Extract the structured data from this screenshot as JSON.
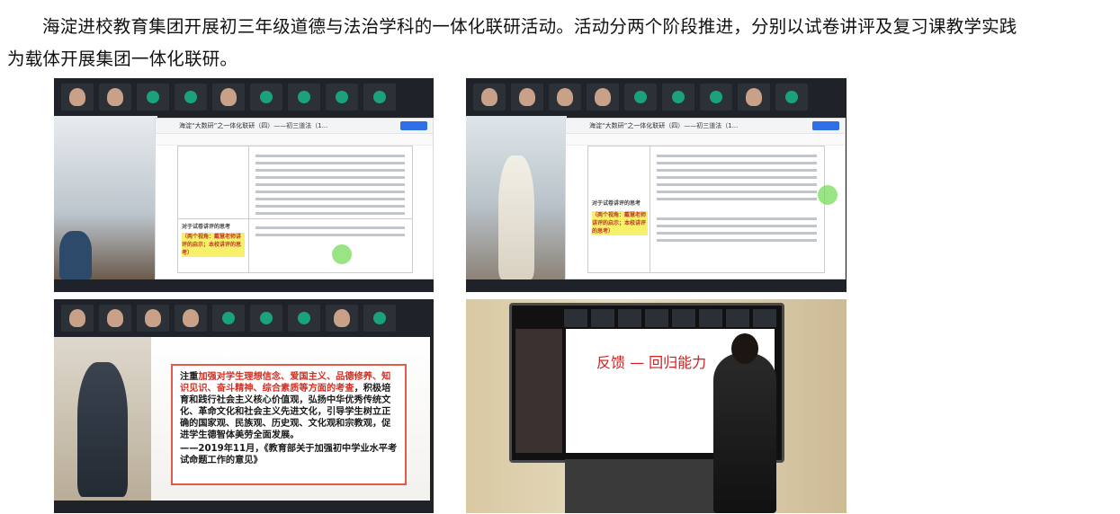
{
  "article": {
    "paragraph_line1": "海淀进校教育集团开展初三年级道德与法治学科的一体化联研活动。活动分两个阶段推进，分别以试卷讲评及复习课教学实践",
    "paragraph_line2": "为载体开展集团一体化联研。"
  },
  "photos": [
    {
      "doc_title": "海淀“大数研”之一体化联研（四）——初三道法（1...",
      "cell_heading": "对于试卷讲评的思考",
      "highlight": "（两个视角：戴慧老师讲评的启示；本校讲评的思考）"
    },
    {
      "doc_title": "海淀“大数研”之一体化联研（四）——初三道法（1...",
      "cell_heading": "对于试卷讲评的思考",
      "highlight": "（两个视角：戴慧老师讲评的启示；本校讲评的思考）"
    },
    {
      "slide_lines": [
        {
          "text": "注重",
          "red": false
        },
        {
          "text": "加强对学生理想信念、爱国主义、品德修养、知识见识、奋斗精神、综合素质等方面的考查",
          "red": true
        },
        {
          "text": "，积极培育和践行社会主义核心价值观，弘扬中华优秀传统文化、革命文化和社会主义先进文化，引导学生树立正确的国家观、民族观、历史观、文化观和宗教观，促进学生德智体美劳全面发展。",
          "red": false
        }
      ],
      "slide_source": "——2019年11月，《教育部关于加强初中学业水平考试命题工作的意见》"
    },
    {
      "board_handwriting": "反馈 — 回归能力"
    }
  ],
  "colors": {
    "highlight_yellow": "#f6f06a",
    "slide_red": "#d62d20",
    "share_button_blue": "#2f6fe5"
  }
}
